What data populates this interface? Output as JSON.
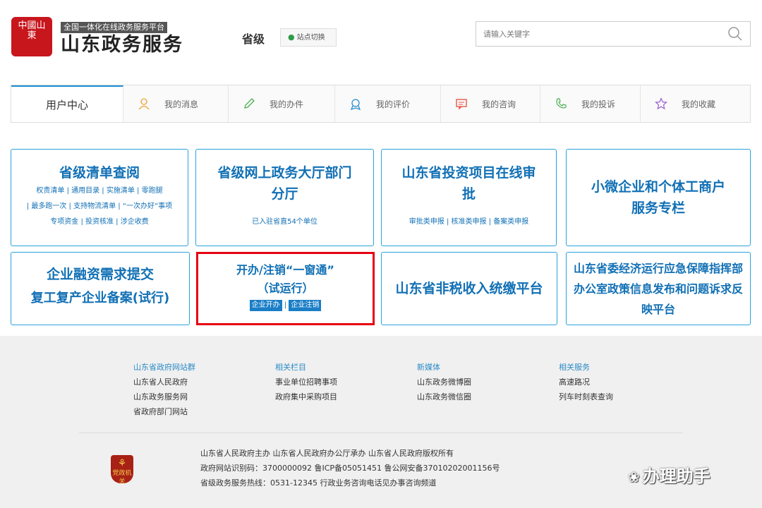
{
  "header": {
    "logo_text": "中國山東",
    "slogan": "全国一体化在线政务服务平台",
    "title": "山东政务服务",
    "level": "省级",
    "switch_label": "站点切换"
  },
  "search": {
    "placeholder": "请输入关键字"
  },
  "tabs": [
    {
      "label": "用户中心",
      "icon": "user-center"
    },
    {
      "label": "我的消息",
      "icon": "user-icon"
    },
    {
      "label": "我的办件",
      "icon": "pencil-icon"
    },
    {
      "label": "我的评价",
      "icon": "badge-icon"
    },
    {
      "label": "我的咨询",
      "icon": "chat-icon"
    },
    {
      "label": "我的投诉",
      "icon": "phone-icon"
    },
    {
      "label": "我的收藏",
      "icon": "star-icon"
    }
  ],
  "cards": {
    "c1": {
      "title": "省级清单查阅",
      "links": [
        "权责清单 | 通用目录 | 实施清单 | 零跑腿",
        "| 最多跑一次 | 支持物流清单 | “一次办好”事项",
        "专项资金 | 投资核准 | 涉企收费"
      ]
    },
    "c2": {
      "title1": "省级网上政务大厅部门",
      "title2": "分厅",
      "sub": "已入驻省直54个单位"
    },
    "c3": {
      "title1": "山东省投资项目在线审",
      "title2": "批",
      "sub": "审批类申报 | 核准类申报 | 备案类申报"
    },
    "c4": {
      "title1": "小微企业和个体工商户",
      "title2": "服务专栏"
    },
    "c5": {
      "title1": "企业融资需求提交",
      "title2": "复工复产企业备案(试行)"
    },
    "c6": {
      "title1": "开办/注销“一窗通”",
      "title2": "（试运行）",
      "tag1": "企业开办",
      "sep": "|",
      "tag2": "企业注销"
    },
    "c7": {
      "title": "山东省非税收入统缴平台"
    },
    "c8": {
      "line1": "山东省委经济运行应急保障指挥部",
      "line2": "办公室政策信息发布和问题诉求反",
      "line3": "映平台"
    }
  },
  "footer": {
    "columns": [
      {
        "head": "山东省政府网站群",
        "items": [
          "山东省人民政府",
          "山东政务服务网",
          "省政府部门网站"
        ]
      },
      {
        "head": "相关栏目",
        "items": [
          "事业单位招聘事项",
          "政府集中采购项目"
        ]
      },
      {
        "head": "新媒体",
        "items": [
          "山东政务微博圈",
          "山东政务微信圈"
        ]
      },
      {
        "head": "相关服务",
        "items": [
          "高速路况",
          "列车时刻表查询"
        ]
      }
    ],
    "emblem_text": "党政机关",
    "copyright": [
      "山东省人民政府主办   山东省人民政府办公厅承办   山东省人民政府版权所有",
      "政府网站识别码：3700000092   鲁ICP备05051451   鲁公网安备37010202001156号",
      "省级政务服务热线：0531-12345   行政业务咨询电话见办事咨询频道"
    ],
    "watermark": "办理助手"
  },
  "colors": {
    "accent": "#1170b5",
    "card_border": "#2aa3dc",
    "highlight": "#e60012",
    "tab_active": "#1a8fd0"
  }
}
